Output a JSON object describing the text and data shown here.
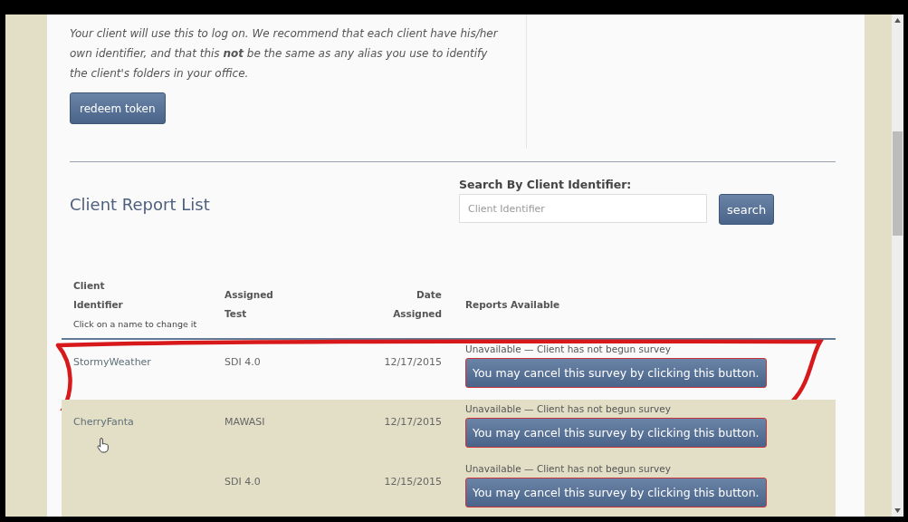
{
  "intro": {
    "text": "Your client will use this to log on. We recommend that each client have his/her own identifier, and that this **not** be the same as any alias you use to identify the client's folders in your office.",
    "button": "redeem token"
  },
  "report_list": {
    "title": "Client Report List",
    "search_label": "Search By Client Identifier:",
    "search_placeholder": "Client Identifier",
    "search_button": "search"
  },
  "table": {
    "columns": [
      {
        "lines": [
          "Client",
          "Identifier"
        ],
        "note": "Click on a name to change it"
      },
      {
        "lines": [
          "Assigned",
          "Test"
        ]
      },
      {
        "lines": [
          "Date",
          "Assigned"
        ]
      },
      {
        "lines": [
          "Reports Available"
        ]
      }
    ],
    "rows": [
      {
        "identifier": "StormyWeather",
        "test": "SDI 4.0",
        "date": "12/17/2015",
        "status": "Unavailable — Client has not begun survey",
        "button": "You may cancel this survey by clicking this button.",
        "shaded": false,
        "annotated": true
      },
      {
        "identifier": "CherryFanta",
        "test": "MAWASI",
        "date": "12/17/2015",
        "status": "Unavailable — Client has not begun survey",
        "button": "You may cancel this survey by clicking this button.",
        "shaded": true,
        "annotated": false
      },
      {
        "test": "SDI 4.0",
        "date": "12/15/2015",
        "status": "Unavailable — Client has not begun survey",
        "button": "You may cancel this survey by clicking this button.",
        "shaded": true,
        "annotated": false
      }
    ]
  }
}
